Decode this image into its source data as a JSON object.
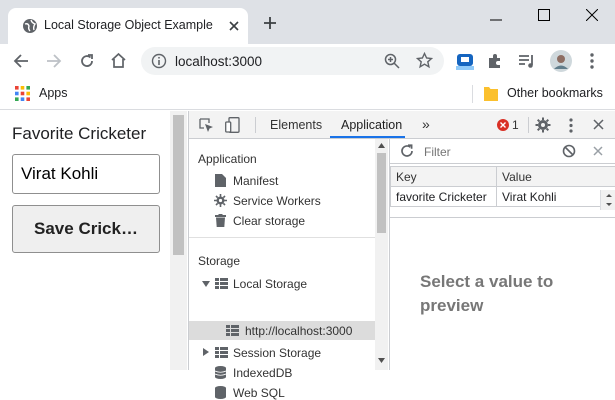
{
  "browser": {
    "tab_title": "Local Storage Object Example",
    "url": "localhost:3000",
    "bookmarks": {
      "apps_label": "Apps",
      "other_label": "Other bookmarks"
    },
    "colors": {
      "frame": "#dee1e6",
      "toolbar": "#ffffff",
      "omnibox": "#f1f3f4"
    }
  },
  "page": {
    "heading": "Favorite Cricketer",
    "input_value": "Virat Kohli",
    "save_button_label": "Save Crick…"
  },
  "devtools": {
    "tabs": [
      "Elements",
      "Application"
    ],
    "more_tabs_glyph": "»",
    "active_tab": "Application",
    "error_count": "1",
    "sidebar": {
      "application_heading": "Application",
      "application_items": [
        "Manifest",
        "Service Workers",
        "Clear storage"
      ],
      "storage_heading": "Storage",
      "local_storage": "Local Storage",
      "local_storage_origin": "http://localhost:3000",
      "session_storage": "Session Storage",
      "indexeddb": "IndexedDB",
      "websql": "Web SQL"
    },
    "filter_placeholder": "Filter",
    "table": {
      "headers": [
        "Key",
        "Value"
      ],
      "rows": [
        {
          "key": "favorite Cricketer",
          "value": "Virat Kohli"
        }
      ]
    },
    "preview_text": "Select a value to preview",
    "colors": {
      "accent": "#1a73e8",
      "error": "#d93025",
      "selected_row": "#dcdcdc"
    }
  }
}
